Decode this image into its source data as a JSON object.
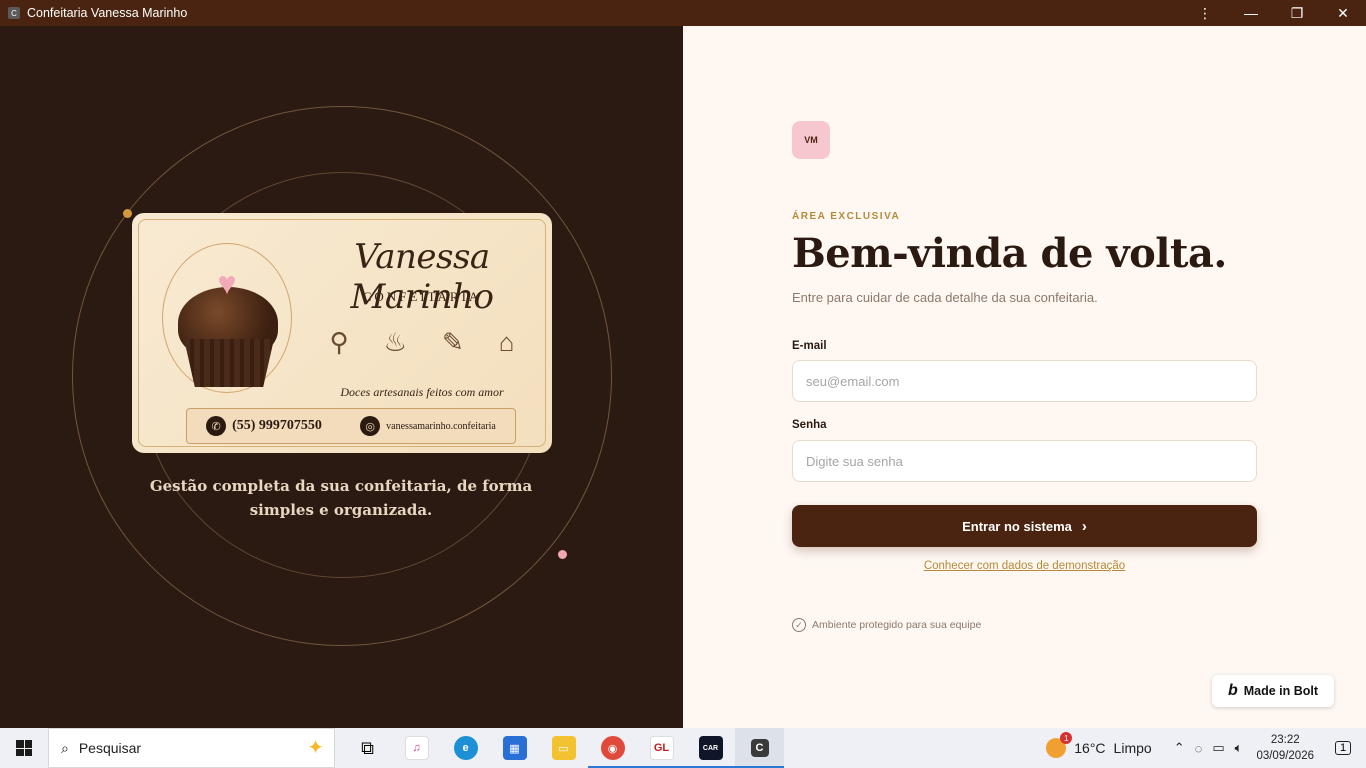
{
  "window": {
    "title": "Confeitaria Vanessa Marinho",
    "icon_letter": "C",
    "controls": {
      "menu": "⋮",
      "minimize": "—",
      "restore": "❐",
      "close": "✕"
    }
  },
  "left": {
    "card": {
      "brand": "Vanessa Marinho",
      "sub": "CONFEITARIA",
      "tagline": "Doces artesanais feitos com amor",
      "phone": "(55) 999707550",
      "instagram": "vanessamarinho.confeitaria"
    },
    "caption": "Gestão completa da sua confeitaria, de forma simples e organizada."
  },
  "login": {
    "logo": "VM",
    "eyebrow": "ÁREA EXCLUSIVA",
    "heading": "Bem-vinda de volta.",
    "subtitle": "Entre para cuidar de cada detalhe da sua confeitaria.",
    "email_label": "E-mail",
    "email_placeholder": "seu@email.com",
    "email_value": "",
    "password_label": "Senha",
    "password_placeholder": "Digite sua senha",
    "password_value": "",
    "submit_label": "Entrar no sistema",
    "demo_link": "Conhecer com dados de demonstração",
    "secure_note": "Ambiente protegido para sua equipe"
  },
  "bolt_badge": "Made in Bolt",
  "taskbar": {
    "search_placeholder": "Pesquisar",
    "weather_temp": "16°C",
    "weather_desc": "Limpo",
    "weather_badge": "1",
    "time": "23:22",
    "date": "03/09/2026",
    "notification_count": "1",
    "apps": [
      {
        "name": "task-view",
        "glyph": "⧉"
      },
      {
        "name": "itunes",
        "glyph": "♫"
      },
      {
        "name": "edge",
        "glyph": "e"
      },
      {
        "name": "store",
        "glyph": "▦"
      },
      {
        "name": "file-explorer",
        "glyph": "▭"
      },
      {
        "name": "chrome",
        "glyph": "◉"
      },
      {
        "name": "gl-app",
        "glyph": "GL"
      },
      {
        "name": "car-app",
        "glyph": "CAR"
      },
      {
        "name": "confeitaria-app",
        "glyph": "C"
      }
    ]
  },
  "colors": {
    "brand_dark": "#4a2410",
    "left_bg": "#2b1a12",
    "right_bg": "#fff8f2",
    "accent_gold": "#b58a3a",
    "accent_pink": "#f6c7cf"
  }
}
